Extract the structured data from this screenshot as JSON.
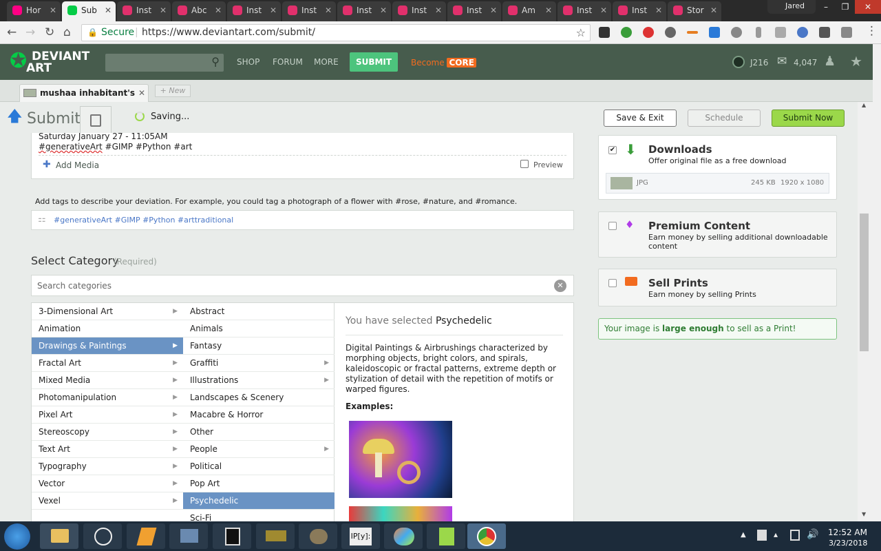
{
  "browser": {
    "tabs": [
      {
        "label": "Hor",
        "icon": "flickr-icon",
        "active": false
      },
      {
        "label": "Sub",
        "icon": "deviantart-icon",
        "active": true
      },
      {
        "label": "Inst",
        "icon": "instagram-icon",
        "active": false
      },
      {
        "label": "Abc",
        "icon": "instagram-icon",
        "active": false
      },
      {
        "label": "Inst",
        "icon": "instagram-icon",
        "active": false
      },
      {
        "label": "Inst",
        "icon": "instagram-icon",
        "active": false
      },
      {
        "label": "Inst",
        "icon": "instagram-icon",
        "active": false
      },
      {
        "label": "Inst",
        "icon": "instagram-icon",
        "active": false
      },
      {
        "label": "Inst",
        "icon": "instagram-icon",
        "active": false
      },
      {
        "label": "Am",
        "icon": "instagram-icon",
        "active": false
      },
      {
        "label": "Inst",
        "icon": "instagram-icon",
        "active": false
      },
      {
        "label": "Inst",
        "icon": "instagram-icon",
        "active": false
      },
      {
        "label": "Stor",
        "icon": "instagram-icon",
        "active": false
      }
    ],
    "profile_name": "Jared",
    "secure_label": "Secure",
    "url": "https://www.deviantart.com/submit/"
  },
  "da_header": {
    "logo_top": "DEVIANT",
    "logo_bottom": "ART",
    "nav": [
      "SHOP",
      "FORUM",
      "MORE"
    ],
    "submit_label": "SUBMIT",
    "become_label": "Become",
    "core_label": "CORE",
    "points": "J216",
    "messages": "4,047"
  },
  "subtabs": {
    "current": "mushaa inhabitant's",
    "new_label": "+ New"
  },
  "submit_bar": {
    "title": "Submit",
    "status": "Saving...",
    "save_exit": "Save & Exit",
    "schedule": "Schedule",
    "submit_now": "Submit Now"
  },
  "editor": {
    "line1": "Saturday January 27 - 11:05AM",
    "line2_tag": "#generativeArt",
    "line2_rest": " #GIMP #Python #art",
    "add_media": "Add Media",
    "preview": "Preview"
  },
  "tags": {
    "hint": "Add tags to describe your deviation. For example, you could tag a photograph of a flower with #rose, #nature, and #romance.",
    "value": "#generativeArt #GIMP #Python #arttraditional"
  },
  "category": {
    "title": "Select Category",
    "required": "(Required)",
    "search_placeholder": "Search categories",
    "col1": [
      {
        "label": "3-Dimensional Art",
        "arrow": true,
        "selected": false
      },
      {
        "label": "Animation",
        "arrow": false,
        "selected": false
      },
      {
        "label": "Drawings & Paintings",
        "arrow": true,
        "selected": true
      },
      {
        "label": "Fractal Art",
        "arrow": true,
        "selected": false
      },
      {
        "label": "Mixed Media",
        "arrow": true,
        "selected": false
      },
      {
        "label": "Photomanipulation",
        "arrow": true,
        "selected": false
      },
      {
        "label": "Pixel Art",
        "arrow": true,
        "selected": false
      },
      {
        "label": "Stereoscopy",
        "arrow": true,
        "selected": false
      },
      {
        "label": "Text Art",
        "arrow": true,
        "selected": false
      },
      {
        "label": "Typography",
        "arrow": true,
        "selected": false
      },
      {
        "label": "Vector",
        "arrow": true,
        "selected": false
      },
      {
        "label": "Vexel",
        "arrow": true,
        "selected": false
      }
    ],
    "col2": [
      {
        "label": "Abstract",
        "arrow": false,
        "selected": false
      },
      {
        "label": "Animals",
        "arrow": false,
        "selected": false
      },
      {
        "label": "Fantasy",
        "arrow": false,
        "selected": false
      },
      {
        "label": "Graffiti",
        "arrow": true,
        "selected": false
      },
      {
        "label": "Illustrations",
        "arrow": true,
        "selected": false
      },
      {
        "label": "Landscapes & Scenery",
        "arrow": false,
        "selected": false
      },
      {
        "label": "Macabre & Horror",
        "arrow": false,
        "selected": false
      },
      {
        "label": "Other",
        "arrow": false,
        "selected": false
      },
      {
        "label": "People",
        "arrow": true,
        "selected": false
      },
      {
        "label": "Political",
        "arrow": false,
        "selected": false
      },
      {
        "label": "Pop Art",
        "arrow": false,
        "selected": false
      },
      {
        "label": "Psychedelic",
        "arrow": false,
        "selected": true
      },
      {
        "label": "Sci-Fi",
        "arrow": false,
        "selected": false
      }
    ],
    "selected_prefix": "You have selected",
    "selected_name": "Psychedelic",
    "description": "Digital Paintings & Airbrushings characterized by morphing objects, bright colors, and spirals, kaleidoscopic or fractal patterns, extreme depth or stylization of detail with the repetition of motifs or warped figures.",
    "examples_label": "Examples:"
  },
  "right": {
    "downloads_title": "Downloads",
    "downloads_desc": "Offer original file as a free download",
    "file_type": "JPG",
    "file_size": "245 KB",
    "file_dims": "1920 x 1080",
    "premium_title": "Premium Content",
    "premium_desc": "Earn money by selling additional downloadable content",
    "prints_title": "Sell Prints",
    "prints_desc": "Earn money by selling Prints",
    "print_msg_a": "Your image is ",
    "print_msg_b": "large enough",
    "print_msg_c": " to sell as a Print!"
  },
  "taskbar": {
    "time": "12:52 AM",
    "date": "3/23/2018"
  },
  "colors": {
    "da_green": "#475c4d",
    "submit_green": "#4dc47d",
    "selected_blue": "#6a93c4",
    "submit_now": "#9bd84a",
    "core_orange": "#f26b1f"
  }
}
